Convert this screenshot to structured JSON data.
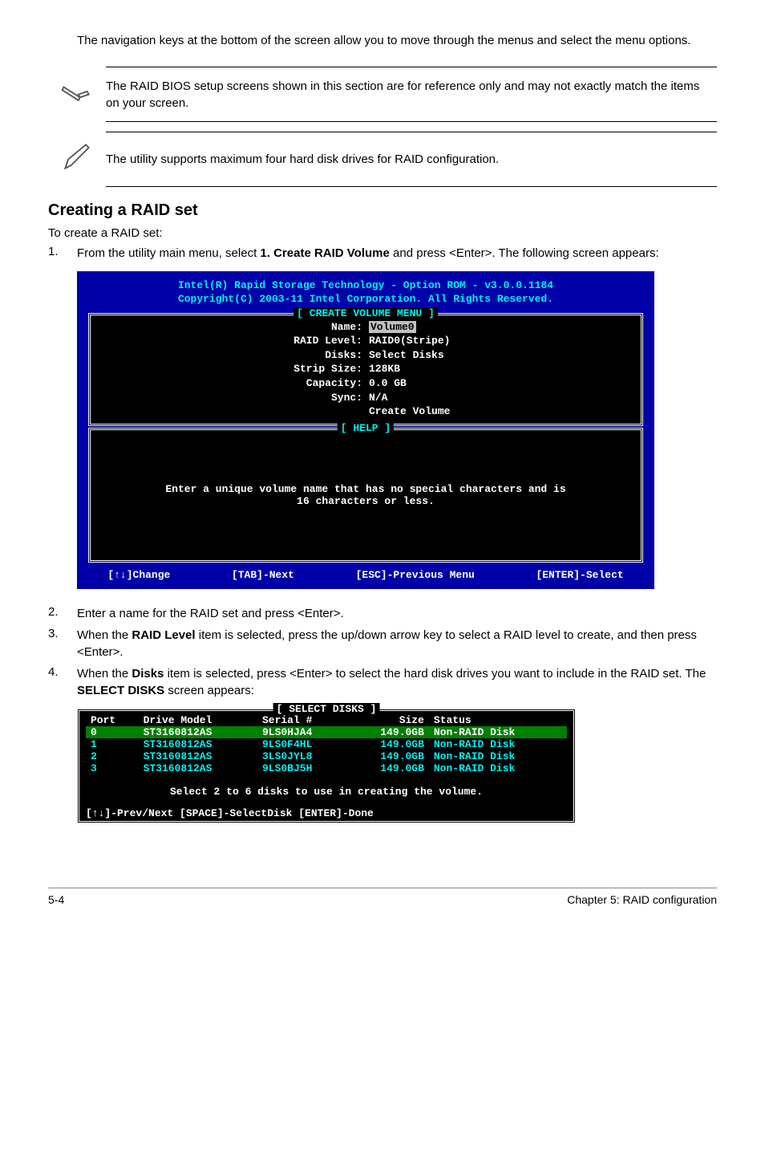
{
  "intro": "The navigation keys at the bottom of the screen allow you to move through the menus and select the menu options.",
  "note1": "The RAID BIOS setup screens shown in this section are for reference only and may not exactly match the items on your screen.",
  "note2": "The utility supports maximum four hard disk drives for RAID configuration.",
  "section_heading": "Creating a RAID set",
  "section_intro": "To create a RAID set:",
  "step1_num": "1.",
  "step1_pre": "From the utility main menu, select ",
  "step1_bold": "1. Create RAID Volume",
  "step1_post": " and press <Enter>. The following screen appears:",
  "bios": {
    "header_line1": "Intel(R) Rapid Storage Technology - Option ROM - v3.0.0.1184",
    "header_line2": "Copyright(C) 2003-11 Intel Corporation.  All Rights Reserved.",
    "create_title": "[ CREATE VOLUME MENU ]",
    "fields": {
      "name_k": "Name:",
      "name_v": "Volume0",
      "raid_k": "RAID Level:",
      "raid_v": "RAID0(Stripe)",
      "disks_k": "Disks:",
      "disks_v": "Select Disks",
      "strip_k": "Strip Size:",
      "strip_v": " 128KB",
      "cap_k": "Capacity:",
      "cap_v": "0.0   GB",
      "sync_k": "Sync:",
      "sync_v": "N/A",
      "create_v": "Create Volume"
    },
    "help_title": "[ HELP ]",
    "help_line1": "Enter a unique volume name that has no special characters and is",
    "help_line2": "16 characters or less.",
    "nav": {
      "change": "[↑↓]Change",
      "next": "[TAB]-Next",
      "prev": "[ESC]-Previous Menu",
      "select": "[ENTER]-Select"
    }
  },
  "step2_num": "2.",
  "step2": "Enter a name for the RAID set and press <Enter>.",
  "step3_num": "3.",
  "step3_pre": "When the ",
  "step3_bold": "RAID Level",
  "step3_post": " item is selected, press the up/down arrow key to select a RAID level to create, and then press <Enter>.",
  "step4_num": "4.",
  "step4_pre": "When the ",
  "step4_bold1": "Disks",
  "step4_mid": " item is selected, press <Enter> to select the hard disk drives you want to include in the RAID set. The ",
  "step4_bold2": "SELECT DISKS",
  "step4_post": " screen appears:",
  "disks": {
    "title": "[ SELECT DISKS ]",
    "headers": {
      "port": "Port",
      "model": "Drive Model",
      "serial": "Serial #",
      "size": "Size",
      "status": "Status"
    },
    "rows": [
      {
        "port": "0",
        "model": "ST3160812AS",
        "serial": "9LS0HJA4",
        "size": "149.0GB",
        "status": "Non-RAID Disk",
        "selected": true
      },
      {
        "port": "1",
        "model": "ST3160812AS",
        "serial": "9LS0F4HL",
        "size": "149.0GB",
        "status": "Non-RAID Disk",
        "selected": false
      },
      {
        "port": "2",
        "model": "ST3160812AS",
        "serial": "3LS0JYL8",
        "size": "149.0GB",
        "status": "Non-RAID Disk",
        "selected": false
      },
      {
        "port": "3",
        "model": "ST3160812AS",
        "serial": "9LS0BJ5H",
        "size": "149.0GB",
        "status": "Non-RAID Disk",
        "selected": false
      }
    ],
    "msg": "Select 2 to 6 disks to use in creating the volume.",
    "nav": "[↑↓]-Prev/Next [SPACE]-SelectDisk [ENTER]-Done"
  },
  "footer_left": "5-4",
  "footer_right": "Chapter 5: RAID configuration"
}
